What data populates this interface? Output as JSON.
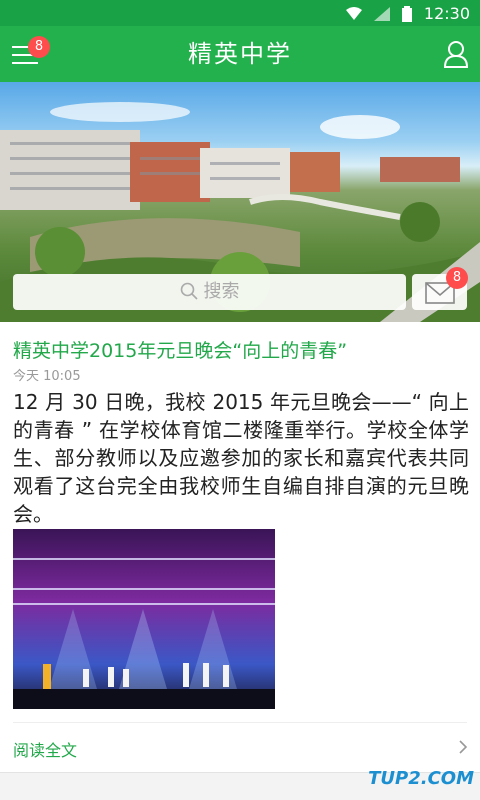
{
  "status_bar": {
    "time": "12:30"
  },
  "app_bar": {
    "title": "精英中学",
    "menu_badge": "8"
  },
  "search": {
    "placeholder": "搜索",
    "mail_badge": "8"
  },
  "article": {
    "title": "精英中学2015年元旦晚会“向上的青春”",
    "time": "今天 10:05",
    "body": "12 月 30 日晚，我校 2015 年元旦晚会——“ 向上的青春 ” 在学校体育馆二楼隆重举行。学校全体学生、部分教师以及应邀参加的家长和嘉宾代表共同观看了这台完全由我校师生自编自排自演的元旦晚会。",
    "read_more": "阅读全文"
  },
  "watermark": "TUP2.COM"
}
